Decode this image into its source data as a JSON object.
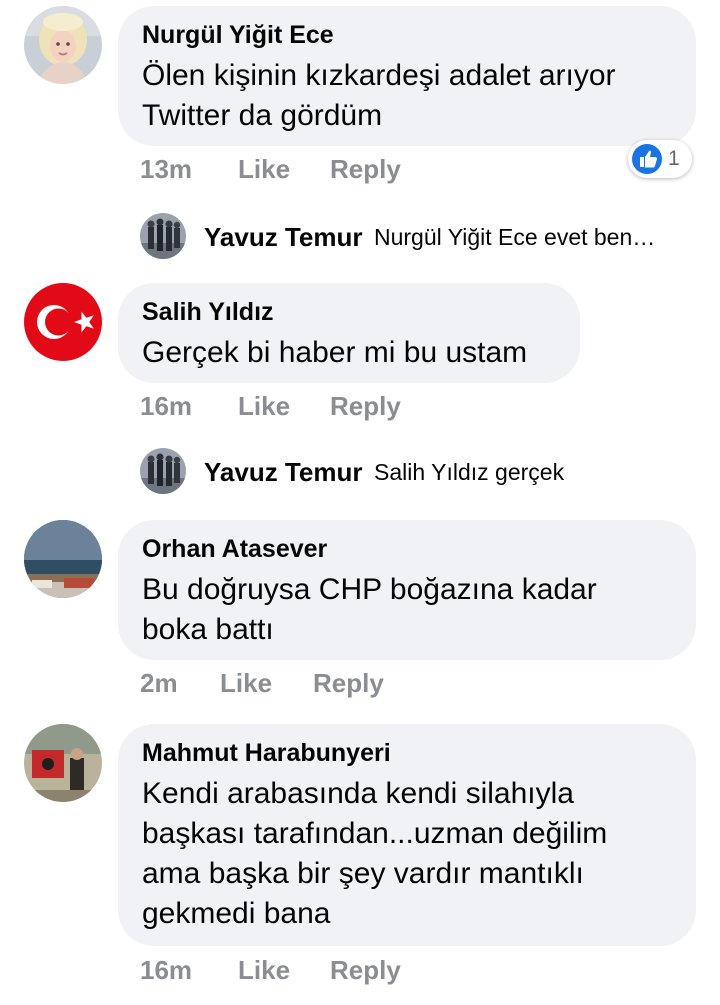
{
  "comments": [
    {
      "author": "Nurgül Yiğit Ece",
      "lines": [
        "Ölen kişinin kızkardeşi adalet arıyor",
        "Twitter da gördüm"
      ],
      "time": "13m",
      "like": "Like",
      "reply": "Reply",
      "reaction": {
        "icon": "thumbs-up-icon",
        "count": "1",
        "color": "#1b74e4"
      },
      "avatar": "avatar-woman-blonde"
    },
    {
      "author": "Salih Yıldız",
      "lines": [
        "Gerçek bi haber mi bu ustam"
      ],
      "time": "16m",
      "like": "Like",
      "reply": "Reply",
      "avatar": "turkish-flag-icon"
    },
    {
      "author": "Orhan Atasever",
      "lines": [
        "Bu doğruysa CHP boğazına kadar",
        "boka battı"
      ],
      "time": "2m",
      "like": "Like",
      "reply": "Reply",
      "avatar": "avatar-sea-landscape"
    },
    {
      "author": "Mahmut Harabunyeri",
      "lines": [
        "Kendi arabasında kendi silahıyla",
        "başkası tarafından...uzman değilim",
        "ama başka bir şey vardır mantıklı",
        "gekmedi bana"
      ],
      "time": "16m",
      "like": "Like",
      "reply": "Reply",
      "avatar": "avatar-man-with-flag"
    }
  ],
  "replies": [
    {
      "author": "Yavuz Temur",
      "text": "Nurgül Yiğit Ece evet ben…",
      "avatar": "avatar-group-photo"
    },
    {
      "author": "Yavuz Temur",
      "text": "Salih Yıldız gerçek",
      "avatar": "avatar-group-photo"
    }
  ],
  "colors": {
    "bubble": "#f0f2f5",
    "meta": "#8a8d91",
    "like_blue": "#1b74e4",
    "flag_red": "#e30a17"
  }
}
